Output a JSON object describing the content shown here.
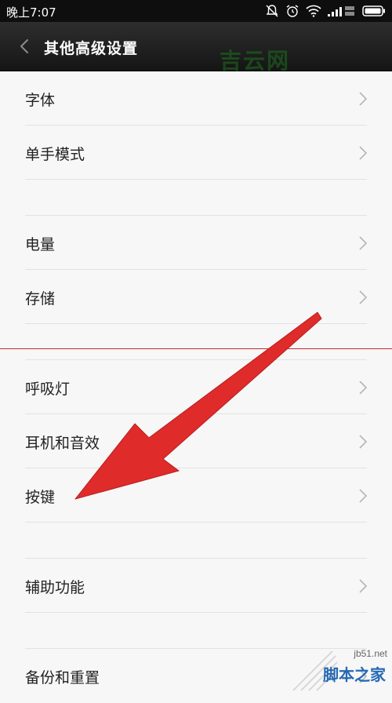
{
  "status_bar": {
    "time": "晚上7:07",
    "icons": [
      "mute-icon",
      "alarm-icon",
      "wifi-icon",
      "signal-icon",
      "battery-icon"
    ]
  },
  "header": {
    "title": "其他高级设置",
    "back_icon": "back-arrow-icon",
    "background": "#1f1f1f"
  },
  "watermarks": {
    "top": "吉云网",
    "site_url": "jb51.net",
    "site_name": "脚本之家"
  },
  "settings_items": [
    {
      "label": "字体"
    },
    {
      "label": "单手模式"
    },
    {
      "label": "电量"
    },
    {
      "label": "存储"
    },
    {
      "label": "呼吸灯"
    },
    {
      "label": "耳机和音效"
    },
    {
      "label": "按键"
    },
    {
      "label": "辅助功能"
    },
    {
      "label": "备份和重置"
    }
  ],
  "colors": {
    "annotation_arrow": "#e02b2b",
    "annotation_line": "#c3282b"
  }
}
